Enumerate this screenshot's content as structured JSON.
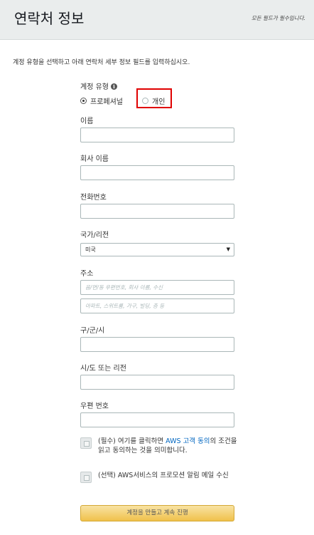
{
  "header": {
    "title": "연락처 정보",
    "required_note": "모든 필드가 필수입니다."
  },
  "instruction": "계정 유형을 선택하고 아래 연락처 세부 정보 필드를 입력하십시오.",
  "account_type": {
    "label": "계정 유형",
    "info_icon": "i",
    "options": [
      {
        "label": "프로페셔널",
        "selected": true
      },
      {
        "label": "개인",
        "selected": false
      }
    ],
    "highlight_color": "#e00000"
  },
  "fields": {
    "name": {
      "label": "이름",
      "value": ""
    },
    "company": {
      "label": "회사 이름",
      "value": ""
    },
    "phone": {
      "label": "전화번호",
      "value": ""
    },
    "country": {
      "label": "국가/리전",
      "value": "미국"
    },
    "address": {
      "label": "주소",
      "line1_placeholder": "음/면/동 우편번호, 회사 이름, 수신",
      "line2_placeholder": "아파트, 스위트룸, 가구, 빌딩, 층 등"
    },
    "city": {
      "label": "구/군/시",
      "value": ""
    },
    "state": {
      "label": "시/도 또는 리전",
      "value": ""
    },
    "postal": {
      "label": "우편 번호",
      "value": ""
    }
  },
  "agreements": {
    "required": {
      "prefix": "(필수) 여기를 클릭하면 ",
      "link": "AWS 고객 동의",
      "suffix": "의 조건을 읽고 동의하는 것을 의미합니다."
    },
    "optional": {
      "text": "(선택) AWS서비스의 프로모션 알림 메일 수신"
    }
  },
  "submit_label": "계정을 만들고 계속 진행",
  "colors": {
    "link": "#0066c0",
    "button": "#f0c14b"
  }
}
